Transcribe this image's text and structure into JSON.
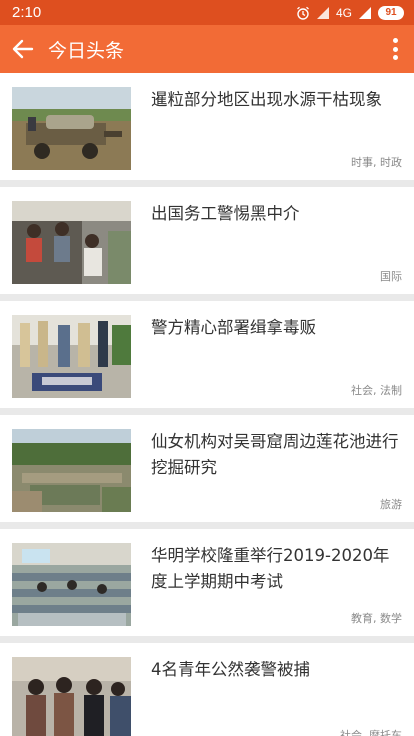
{
  "status_bar": {
    "time": "2:10",
    "network": "4G",
    "battery": "91",
    "icons": [
      "alarm-icon",
      "hd-signal-icon",
      "signal-icon",
      "battery-icon"
    ]
  },
  "app_bar": {
    "title": "今日头条",
    "back_icon": "arrow-left-icon",
    "menu_icon": "more-vertical-icon",
    "color": "#f26b36"
  },
  "news": [
    {
      "title": "暹粒部分地区出现水源干枯现象",
      "tags": "时事, 时政",
      "thumb": "water-truck-photo"
    },
    {
      "title": "出国务工警惕黑中介",
      "tags": "国际",
      "thumb": "workers-truck-photo"
    },
    {
      "title": "警方精心部署缉拿毒贩",
      "tags": "社会, 法制",
      "thumb": "police-drug-bust-photo"
    },
    {
      "title": "仙女机构对吴哥窟周边莲花池进行挖掘研究",
      "tags": "旅游",
      "thumb": "excavation-site-photo"
    },
    {
      "title": "华明学校隆重举行2019-2020年度上学期期中考试",
      "tags": "教育, 数学",
      "thumb": "exam-classroom-photo"
    },
    {
      "title": "4名青年公然袭警被捕",
      "tags": "社会, 摩托车",
      "thumb": "arrested-youths-photo"
    }
  ]
}
